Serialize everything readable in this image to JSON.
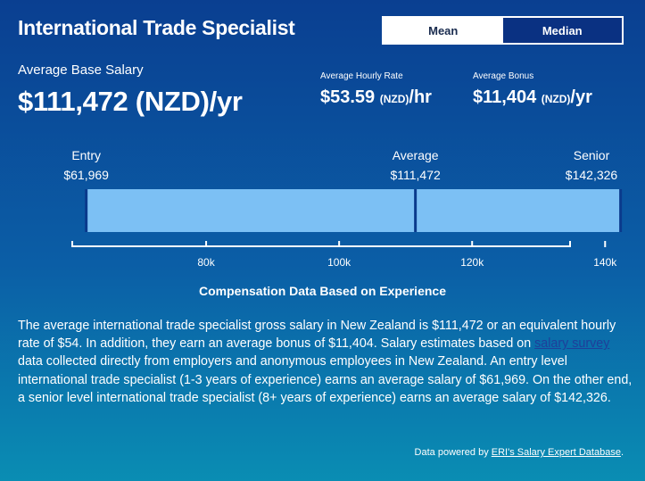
{
  "header": {
    "title": "International Trade Specialist"
  },
  "toggle": {
    "mean_label": "Mean",
    "median_label": "Median"
  },
  "base": {
    "label": "Average Base Salary",
    "value": "$111,472 (NZD)/yr"
  },
  "hourly": {
    "label": "Average Hourly Rate",
    "amount": "$53.59",
    "currency": "(NZD)",
    "unit": "/hr"
  },
  "bonus": {
    "label": "Average Bonus",
    "amount": "$11,404",
    "currency": "(NZD)",
    "unit": "/yr"
  },
  "colors": {
    "bar_fill": "#7cc0f4",
    "marker_line": "#0a3a8c",
    "accent_active_bg": "#ffffff",
    "accent_inactive_bg": "#0a3182"
  },
  "chart_data": {
    "type": "bar",
    "title": "Compensation Data Based on Experience",
    "xlim": [
      49000,
      146000
    ],
    "ticks": [
      {
        "value": 80000,
        "label": "80k"
      },
      {
        "value": 100000,
        "label": "100k"
      },
      {
        "value": 120000,
        "label": "120k"
      },
      {
        "value": 140000,
        "label": "140k"
      }
    ],
    "range": {
      "start": 61969,
      "end": 142326
    },
    "markers": [
      {
        "name": "Entry",
        "value": 61969,
        "label": "$61,969"
      },
      {
        "name": "Average",
        "value": 111472,
        "label": "$111,472"
      },
      {
        "name": "Senior",
        "value": 142326,
        "label": "$142,326"
      }
    ]
  },
  "description": {
    "part1": "The average international trade specialist gross salary in New Zealand is $111,472 or an equivalent hourly rate of $54. In addition, they earn an average bonus of $11,404. Salary estimates based on ",
    "link": "salary survey",
    "part2": " data collected directly from employers and anonymous employees in New Zealand. An entry level international trade specialist (1-3 years of experience) earns an average salary of $61,969. On the other end, a senior level international trade specialist (8+ years of experience) earns an average salary of $142,326."
  },
  "footer": {
    "prefix": "Data powered by ",
    "link": "ERI's Salary Expert Database",
    "suffix": "."
  }
}
